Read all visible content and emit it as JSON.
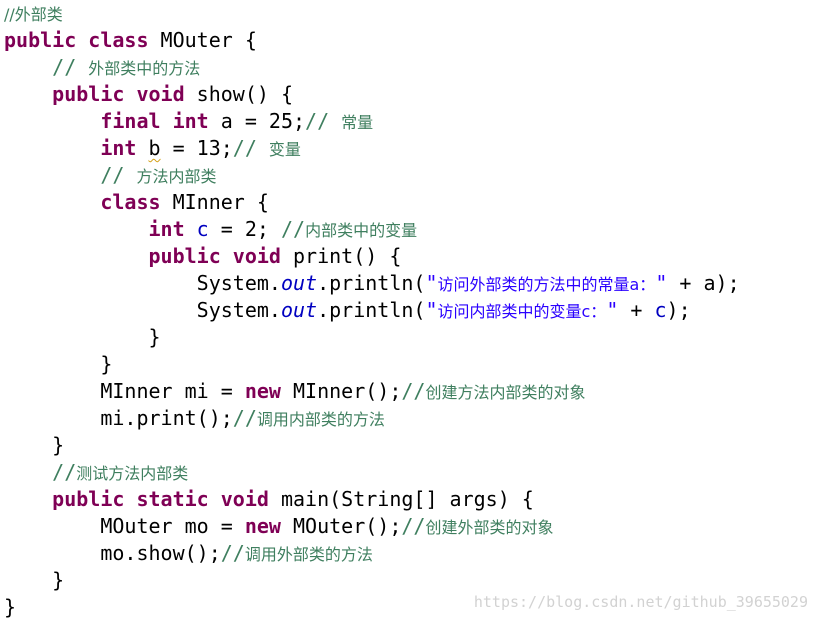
{
  "editor": {
    "lines": [
      {
        "indent": "",
        "tokens": [
          {
            "t": "cm cm-cjk",
            "v": "//外部类"
          }
        ]
      },
      {
        "indent": "",
        "tokens": [
          {
            "t": "kw",
            "v": "public"
          },
          {
            "t": "plain",
            "v": " "
          },
          {
            "t": "kw",
            "v": "class"
          },
          {
            "t": "plain",
            "v": " MOuter {"
          }
        ]
      },
      {
        "indent": "    ",
        "tokens": [
          {
            "t": "cm",
            "v": "// "
          },
          {
            "t": "cm cm-cjk",
            "v": "外部类中的方法"
          }
        ]
      },
      {
        "indent": "    ",
        "tokens": [
          {
            "t": "kw",
            "v": "public"
          },
          {
            "t": "plain",
            "v": " "
          },
          {
            "t": "kw",
            "v": "void"
          },
          {
            "t": "plain",
            "v": " show() {"
          }
        ]
      },
      {
        "indent": "        ",
        "tokens": [
          {
            "t": "kw",
            "v": "final"
          },
          {
            "t": "plain",
            "v": " "
          },
          {
            "t": "kw",
            "v": "int"
          },
          {
            "t": "plain",
            "v": " a = 25;"
          },
          {
            "t": "cm",
            "v": "// "
          },
          {
            "t": "cm cm-cjk",
            "v": "常量"
          }
        ]
      },
      {
        "indent": "        ",
        "tokens": [
          {
            "t": "kw",
            "v": "int"
          },
          {
            "t": "plain",
            "v": " "
          },
          {
            "t": "plain squiggle",
            "v": "b"
          },
          {
            "t": "plain",
            "v": " = 13;"
          },
          {
            "t": "cm",
            "v": "// "
          },
          {
            "t": "cm cm-cjk",
            "v": "变量"
          }
        ]
      },
      {
        "indent": "        ",
        "tokens": [
          {
            "t": "cm",
            "v": "// "
          },
          {
            "t": "cm cm-cjk",
            "v": "方法内部类"
          }
        ]
      },
      {
        "indent": "        ",
        "tokens": [
          {
            "t": "kw",
            "v": "class"
          },
          {
            "t": "plain",
            "v": " MInner {"
          }
        ]
      },
      {
        "indent": "            ",
        "tokens": [
          {
            "t": "kw",
            "v": "int"
          },
          {
            "t": "plain",
            "v": " "
          },
          {
            "t": "fld",
            "v": "c"
          },
          {
            "t": "plain",
            "v": " = 2; "
          },
          {
            "t": "cm",
            "v": "//"
          },
          {
            "t": "cm cm-cjk",
            "v": "内部类中的变量"
          }
        ]
      },
      {
        "indent": "            ",
        "tokens": [
          {
            "t": "kw",
            "v": "public"
          },
          {
            "t": "plain",
            "v": " "
          },
          {
            "t": "kw",
            "v": "void"
          },
          {
            "t": "plain",
            "v": " print() {"
          }
        ]
      },
      {
        "indent": "                ",
        "tokens": [
          {
            "t": "plain",
            "v": "System."
          },
          {
            "t": "sfld",
            "v": "out"
          },
          {
            "t": "plain",
            "v": ".println("
          },
          {
            "t": "str",
            "v": "\""
          },
          {
            "t": "str str-cjk",
            "v": "访问外部类的方法中的常量a："
          },
          {
            "t": "str",
            "v": "\""
          },
          {
            "t": "plain",
            "v": " + a);"
          }
        ]
      },
      {
        "indent": "                ",
        "tokens": [
          {
            "t": "plain",
            "v": "System."
          },
          {
            "t": "sfld",
            "v": "out"
          },
          {
            "t": "plain",
            "v": ".println("
          },
          {
            "t": "str",
            "v": "\""
          },
          {
            "t": "str str-cjk",
            "v": "访问内部类中的变量c："
          },
          {
            "t": "str",
            "v": "\""
          },
          {
            "t": "plain",
            "v": " + "
          },
          {
            "t": "fld",
            "v": "c"
          },
          {
            "t": "plain",
            "v": ");"
          }
        ]
      },
      {
        "indent": "            ",
        "tokens": [
          {
            "t": "plain",
            "v": "}"
          }
        ]
      },
      {
        "indent": "        ",
        "tokens": [
          {
            "t": "plain",
            "v": "}"
          }
        ]
      },
      {
        "indent": "        ",
        "tokens": [
          {
            "t": "plain",
            "v": "MInner mi = "
          },
          {
            "t": "kw",
            "v": "new"
          },
          {
            "t": "plain",
            "v": " MInner();"
          },
          {
            "t": "cm",
            "v": "//"
          },
          {
            "t": "cm cm-cjk",
            "v": "创建方法内部类的对象"
          }
        ]
      },
      {
        "indent": "        ",
        "tokens": [
          {
            "t": "plain",
            "v": "mi.print();"
          },
          {
            "t": "cm",
            "v": "//"
          },
          {
            "t": "cm cm-cjk",
            "v": "调用内部类的方法"
          }
        ]
      },
      {
        "indent": "    ",
        "tokens": [
          {
            "t": "plain",
            "v": "}"
          }
        ]
      },
      {
        "indent": "    ",
        "tokens": [
          {
            "t": "cm",
            "v": "//"
          },
          {
            "t": "cm cm-cjk",
            "v": "测试方法内部类"
          }
        ]
      },
      {
        "indent": "    ",
        "tokens": [
          {
            "t": "kw",
            "v": "public"
          },
          {
            "t": "plain",
            "v": " "
          },
          {
            "t": "kw",
            "v": "static"
          },
          {
            "t": "plain",
            "v": " "
          },
          {
            "t": "kw",
            "v": "void"
          },
          {
            "t": "plain",
            "v": " main(String[] args) {"
          }
        ]
      },
      {
        "indent": "        ",
        "tokens": [
          {
            "t": "plain",
            "v": "MOuter mo = "
          },
          {
            "t": "kw",
            "v": "new"
          },
          {
            "t": "plain",
            "v": " MOuter();"
          },
          {
            "t": "cm",
            "v": "//"
          },
          {
            "t": "cm cm-cjk",
            "v": "创建外部类的对象"
          }
        ]
      },
      {
        "indent": "        ",
        "tokens": [
          {
            "t": "plain",
            "v": "mo.show();"
          },
          {
            "t": "cm",
            "v": "//"
          },
          {
            "t": "cm cm-cjk",
            "v": "调用外部类的方法"
          }
        ]
      },
      {
        "indent": "    ",
        "tokens": [
          {
            "t": "plain",
            "v": "}"
          }
        ]
      },
      {
        "indent": "",
        "tokens": [
          {
            "t": "plain",
            "v": "}"
          }
        ]
      }
    ]
  },
  "watermark": "https://blog.csdn.net/github_39655029",
  "colors": {
    "keyword": "#7f0055",
    "comment": "#3f7f5f",
    "string": "#2a00ff",
    "field": "#0000c0",
    "text": "#000000",
    "watermark": "#d2d2d2"
  }
}
